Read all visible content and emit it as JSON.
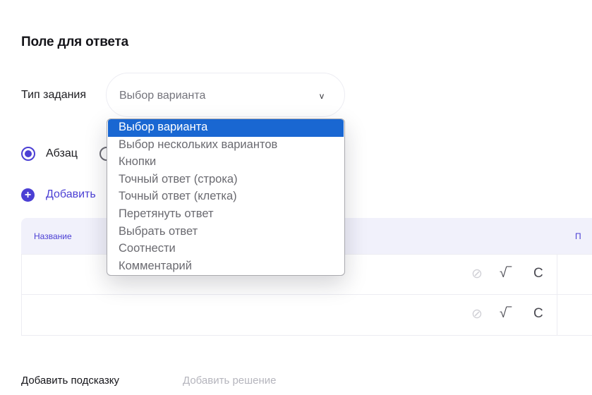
{
  "section": {
    "title": "Поле для ответа"
  },
  "task_type": {
    "label": "Тип задания",
    "value": "Выбор варианта",
    "arrow": "v"
  },
  "dropdown": {
    "options": [
      "Выбор варианта",
      "Выбор нескольких вариантов",
      "Кнопки",
      "Точный ответ (строка)",
      "Точный ответ (клетка)",
      "Перетянуть ответ",
      "Выбрать ответ",
      "Соотнести",
      "Комментарий"
    ],
    "selected_index": 0
  },
  "layout_mode": {
    "paragraph_label": "Абзац",
    "selected": "paragraph"
  },
  "add_button": {
    "label": "Добавить",
    "icon": "plus-circle-icon"
  },
  "table": {
    "columns": [
      "Название",
      "П"
    ],
    "row_icons": {
      "attach": "⊘",
      "sqrt": "√‾",
      "clear": "C"
    },
    "rows": 2
  },
  "footer": {
    "add_hint": "Добавить подсказку",
    "add_solution": "Добавить решение"
  },
  "colors": {
    "accent": "#4b3fd4",
    "selection": "#1967d2",
    "header_bg": "#f1f1fb"
  }
}
